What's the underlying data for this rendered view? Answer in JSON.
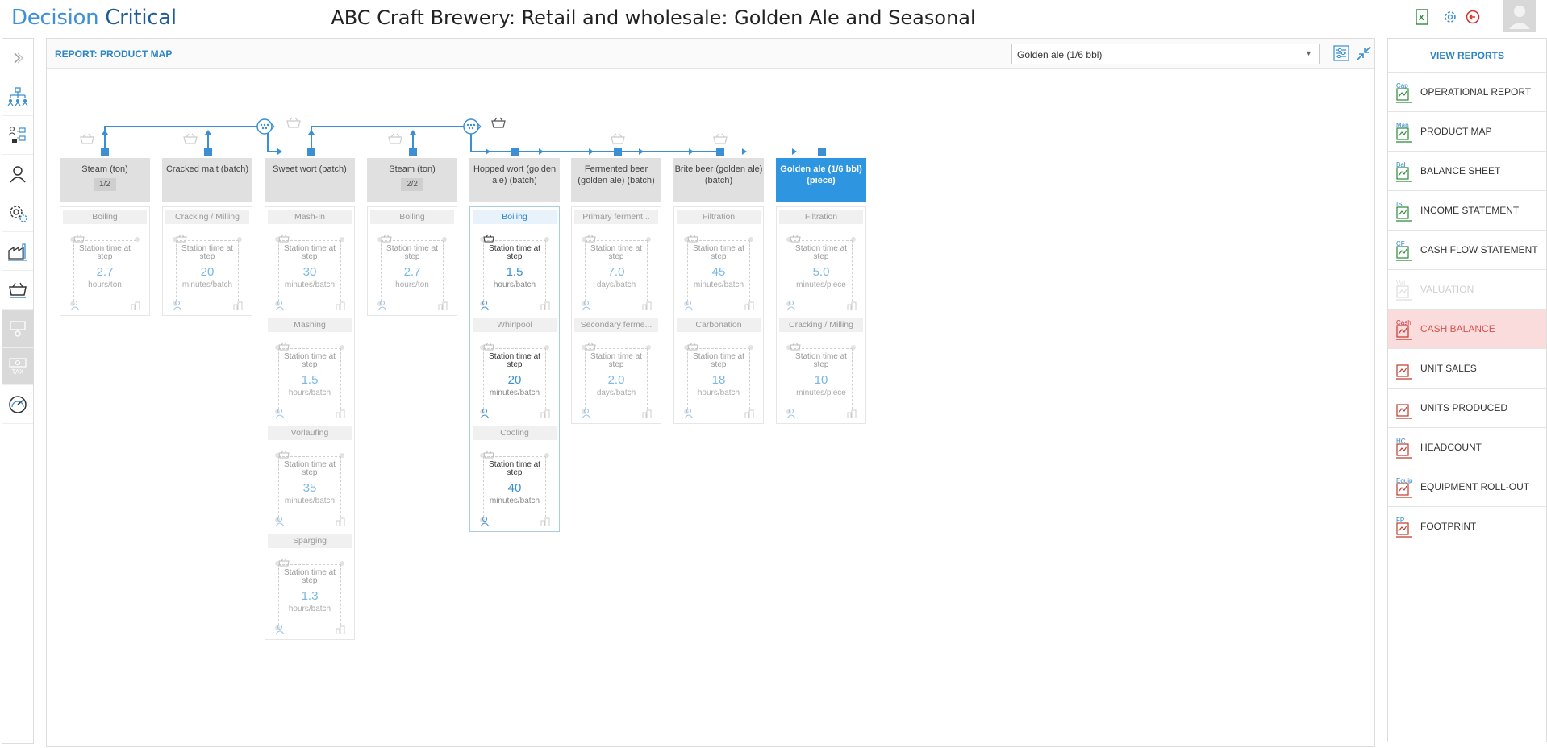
{
  "header": {
    "logo_part1": "Decision",
    "logo_part2": "Critical",
    "title": "ABC Craft Brewery: Retail and wholesale: Golden Ale and Seasonal",
    "icons": [
      "excel-icon",
      "settings-icon",
      "logout-icon",
      "user-avatar-icon"
    ]
  },
  "leftbar": {
    "icons": [
      "expand-icon",
      "org-chart-icon",
      "people-network-icon",
      "person-icon",
      "process-settings-icon",
      "factory-icon",
      "cart-icon",
      "equipment-icon",
      "tax-icon",
      "gauge-icon"
    ],
    "tax_label": "TAX"
  },
  "main": {
    "report_title": "REPORT: PRODUCT MAP",
    "product_selected": "Golden ale (1/6 bbl)",
    "icons": [
      "filter-settings-icon",
      "collapse-icon"
    ]
  },
  "products": [
    {
      "name": "Steam (ton)",
      "badge": "1/2"
    },
    {
      "name": "Cracked malt (batch)",
      "badge": ""
    },
    {
      "name": "Sweet wort (batch)",
      "badge": ""
    },
    {
      "name": "Steam (ton)",
      "badge": "2/2"
    },
    {
      "name": "Hopped wort (golden ale) (batch)",
      "badge": ""
    },
    {
      "name": "Fermented beer (golden ale) (batch)",
      "badge": ""
    },
    {
      "name": "Brite beer (golden ale) (batch)",
      "badge": ""
    },
    {
      "name": "Golden ale (1/6 bbl) (piece)",
      "badge": ""
    }
  ],
  "steps": [
    [
      {
        "name": "Boiling",
        "label": "Station time at step",
        "value": "2.7",
        "unit": "hours/ton"
      }
    ],
    [
      {
        "name": "Cracking / Milling",
        "label": "Station time at step",
        "value": "20",
        "unit": "minutes/batch"
      }
    ],
    [
      {
        "name": "Mash-In",
        "label": "Station time at step",
        "value": "30",
        "unit": "minutes/batch"
      },
      {
        "name": "Mashing",
        "label": "Station time at step",
        "value": "1.5",
        "unit": "hours/batch"
      },
      {
        "name": "Vorlaufing",
        "label": "Station time at step",
        "value": "35",
        "unit": "minutes/batch"
      },
      {
        "name": "Sparging",
        "label": "Station time at step",
        "value": "1.3",
        "unit": "hours/batch"
      }
    ],
    [
      {
        "name": "Boiling",
        "label": "Station time at step",
        "value": "2.7",
        "unit": "hours/ton"
      }
    ],
    [
      {
        "name": "Boiling",
        "label": "Station time at step",
        "value": "1.5",
        "unit": "hours/batch"
      },
      {
        "name": "Whirlpool",
        "label": "Station time at step",
        "value": "20",
        "unit": "minutes/batch"
      },
      {
        "name": "Cooling",
        "label": "Station time at step",
        "value": "40",
        "unit": "minutes/batch"
      }
    ],
    [
      {
        "name": "Primary ferment...",
        "label": "Station time at step",
        "value": "7.0",
        "unit": "days/batch"
      },
      {
        "name": "Secondary ferme...",
        "label": "Station time at step",
        "value": "2.0",
        "unit": "days/batch"
      }
    ],
    [
      {
        "name": "Filtration",
        "label": "Station time at step",
        "value": "45",
        "unit": "minutes/batch"
      },
      {
        "name": "Carbonation",
        "label": "Station time at step",
        "value": "18",
        "unit": "hours/batch"
      }
    ],
    [
      {
        "name": "Filtration",
        "label": "Station time at step",
        "value": "5.0",
        "unit": "minutes/piece"
      },
      {
        "name": "Cracking / Milling",
        "label": "Station time at step",
        "value": "10",
        "unit": "minutes/piece"
      }
    ]
  ],
  "rightbar": {
    "heading": "VIEW REPORTS",
    "items": [
      {
        "label": "OPERATIONAL REPORT",
        "tag": "Cap"
      },
      {
        "label": "PRODUCT MAP",
        "tag": "Map"
      },
      {
        "label": "BALANCE SHEET",
        "tag": "Bal"
      },
      {
        "label": "INCOME STATEMENT",
        "tag": "IS"
      },
      {
        "label": "CASH FLOW STATEMENT",
        "tag": "CF"
      },
      {
        "label": "VALUATION",
        "tag": "Val"
      },
      {
        "label": "CASH BALANCE",
        "tag": "Cash"
      },
      {
        "label": "UNIT SALES",
        "tag": ""
      },
      {
        "label": "UNITS PRODUCED",
        "tag": ""
      },
      {
        "label": "HEADCOUNT",
        "tag": "HC"
      },
      {
        "label": "EQUIPMENT ROLL-OUT",
        "tag": "Equip"
      },
      {
        "label": "FOOTPRINT",
        "tag": "FP"
      }
    ]
  },
  "colors": {
    "accent": "#2e95e0",
    "alert_bg": "#fbdcdc",
    "alert_text": "#d9534f"
  }
}
